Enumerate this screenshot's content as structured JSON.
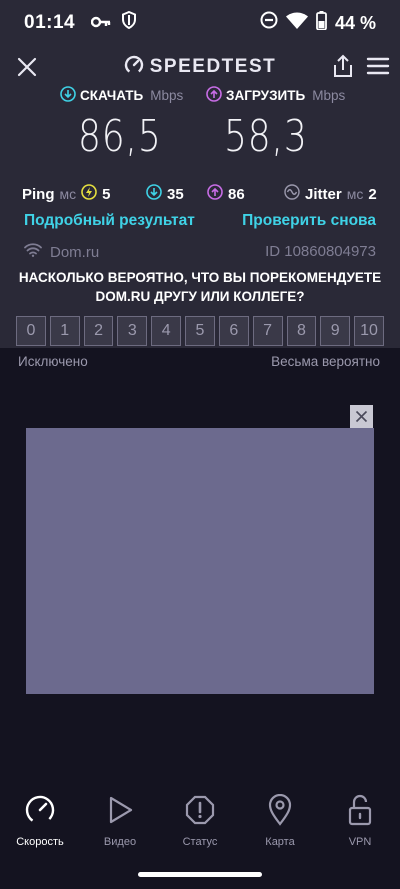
{
  "status_bar": {
    "time": "01:14",
    "battery_pct": "44 %",
    "icons": [
      "key-icon",
      "shield-icon",
      "dnd-icon",
      "wifi-icon",
      "battery-icon"
    ]
  },
  "app": {
    "title": "SPEEDTEST",
    "download": {
      "label": "СКАЧАТЬ",
      "unit": "Mbps",
      "value": "86,5"
    },
    "upload": {
      "label": "ЗАГРУЗИТЬ",
      "unit": "Mbps",
      "value": "58,3"
    },
    "ping": {
      "label": "Ping",
      "unit": "мс",
      "idle": "5",
      "down": "35",
      "up": "86"
    },
    "jitter": {
      "label": "Jitter",
      "unit": "мс",
      "value": "2"
    },
    "links": {
      "details": "Подробный результат",
      "retry": "Проверить снова"
    },
    "provider": {
      "name": "Dom.ru",
      "result_id": "ID 10860804973"
    },
    "survey": {
      "question": "НАСКОЛЬКО ВЕРОЯТНО, ЧТО ВЫ ПОРЕКОМЕНДУЕТЕ DOM.RU ДРУГУ ИЛИ КОЛЛЕГЕ?",
      "scale": [
        "0",
        "1",
        "2",
        "3",
        "4",
        "5",
        "6",
        "7",
        "8",
        "9",
        "10"
      ],
      "low_label": "Исключено",
      "high_label": "Весьма вероятно"
    }
  },
  "nav": [
    {
      "label": "Скорость",
      "icon": "speedometer-icon",
      "active": true
    },
    {
      "label": "Видео",
      "icon": "play-icon",
      "active": false
    },
    {
      "label": "Статус",
      "icon": "alert-icon",
      "active": false
    },
    {
      "label": "Карта",
      "icon": "map-pin-icon",
      "active": false
    },
    {
      "label": "VPN",
      "icon": "lock-open-icon",
      "active": false
    }
  ],
  "colors": {
    "background": "#141320",
    "panel": "#2a2937",
    "accent_cyan": "#3fd2e6",
    "download_icon": "#3fd2e6",
    "upload_icon": "#c86de6",
    "ping_icon": "#e6e03f",
    "ad_area": "#6c6a8e"
  }
}
